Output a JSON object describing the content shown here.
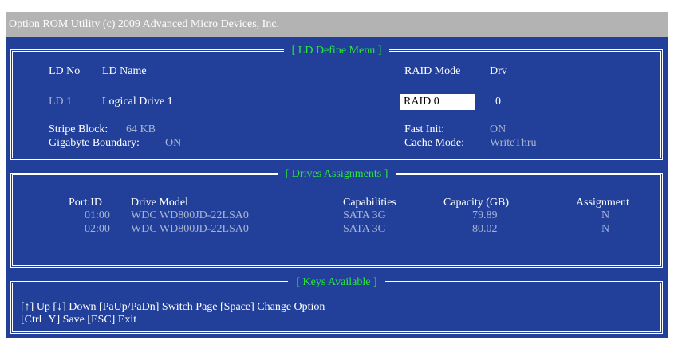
{
  "title": "Option ROM Utility (c) 2009 Advanced Micro Devices, Inc.",
  "ld_define": {
    "heading": "[ LD Define Menu ]",
    "col_ld_no": "LD No",
    "col_ld_name": "LD Name",
    "col_raid_mode": "RAID Mode",
    "col_drv": "Drv",
    "ld_no": "LD 1",
    "ld_name": "Logical Drive 1",
    "raid_mode": "RAID 0",
    "drv": "0",
    "stripe_label": "Stripe Block:",
    "stripe_value": "64  KB",
    "gigabyte_label": "Gigabyte Boundary:",
    "gigabyte_value": "ON",
    "fast_init_label": "Fast Init:",
    "fast_init_value": "ON",
    "cache_label": "Cache Mode:",
    "cache_value": "WriteThru"
  },
  "drives": {
    "heading": "[ Drives Assignments ]",
    "headers": [
      "Port:ID",
      "Drive Model",
      "Capabilities",
      "Capacity (GB)",
      "Assignment"
    ],
    "rows": [
      [
        "01:00",
        "WDC WD800JD-22LSA0",
        "SATA 3G",
        "79.89",
        "N"
      ],
      [
        "02:00",
        "WDC WD800JD-22LSA0",
        "SATA 3G",
        "80.02",
        "N"
      ]
    ]
  },
  "keys": {
    "heading": "[ Keys Available ]",
    "line1": "[↑] Up   [↓] Down   [PaUp/PaDn] Switch Page   [Space] Change Option",
    "line2": "[Ctrl+Y] Save  [ESC] Exit"
  },
  "colors": {
    "background": "#22409a",
    "title_bar": "#b3b3b3",
    "heading": "#29e83a",
    "inactive_text": "#a8b4d0",
    "highlight": "#ffffff"
  }
}
